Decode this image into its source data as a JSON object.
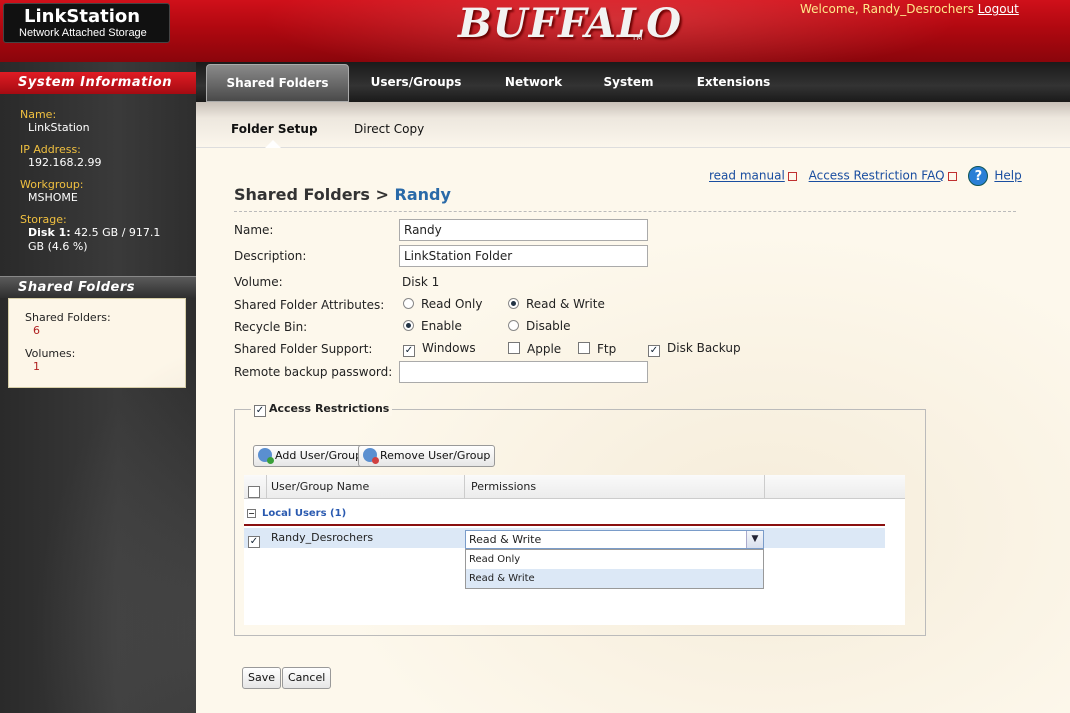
{
  "header": {
    "product_name": "LinkStation",
    "product_subtitle": "Network Attached Storage",
    "brand": "BUFFALO",
    "brand_tm": "TM",
    "welcome_text": "Welcome, Randy_Desrochers",
    "logout_label": "Logout"
  },
  "sidebar": {
    "system_info_title": "System Information",
    "name_label": "Name:",
    "name_value": "LinkStation",
    "ip_label": "IP Address:",
    "ip_value": "192.168.2.99",
    "workgroup_label": "Workgroup:",
    "workgroup_value": "MSHOME",
    "storage_label": "Storage:",
    "storage_disk": "Disk 1:",
    "storage_value": "42.5 GB / 917.1",
    "storage_value2": "GB (4.6 %)",
    "shared_title": "Shared Folders",
    "shared_count_label": "Shared Folders:",
    "shared_count": "6",
    "volumes_label": "Volumes:",
    "volumes_count": "1"
  },
  "tabs": [
    "Shared Folders",
    "Users/Groups",
    "Network",
    "System",
    "Extensions"
  ],
  "subtabs": [
    "Folder Setup",
    "Direct Copy"
  ],
  "links": {
    "read_manual": "read manual",
    "faq": "Access Restriction FAQ",
    "help": "Help",
    "help_icon_char": "?"
  },
  "page": {
    "title_prefix": "Shared Folders >",
    "title_current": "Randy"
  },
  "form": {
    "name_label": "Name:",
    "name_value": "Randy",
    "desc_label": "Description:",
    "desc_value": "LinkStation Folder",
    "volume_label": "Volume:",
    "volume_value": "Disk 1",
    "attr_label": "Shared Folder Attributes:",
    "attr_read_only": "Read Only",
    "attr_read_write": "Read & Write",
    "recycle_label": "Recycle Bin:",
    "recycle_enable": "Enable",
    "recycle_disable": "Disable",
    "support_label": "Shared Folder Support:",
    "support_windows": "Windows",
    "support_apple": "Apple",
    "support_ftp": "Ftp",
    "support_disk_backup": "Disk Backup",
    "remote_pw_label": "Remote backup password:",
    "remote_pw_value": ""
  },
  "access": {
    "legend": "Access Restrictions",
    "add_label": "Add User/Group",
    "remove_label": "Remove User/Group",
    "col_name": "User/Group Name",
    "col_perm": "Permissions",
    "group_label": "Local Users (1)",
    "user_name": "Randy_Desrochers",
    "perm_value": "Read & Write",
    "options": [
      "Read Only",
      "Read & Write"
    ]
  },
  "footer": {
    "save_label": "Save",
    "cancel_label": "Cancel"
  },
  "colors": {
    "brand_red": "#b00810",
    "link_blue": "#1a4ea0",
    "title_blue": "#2a6aa8"
  }
}
